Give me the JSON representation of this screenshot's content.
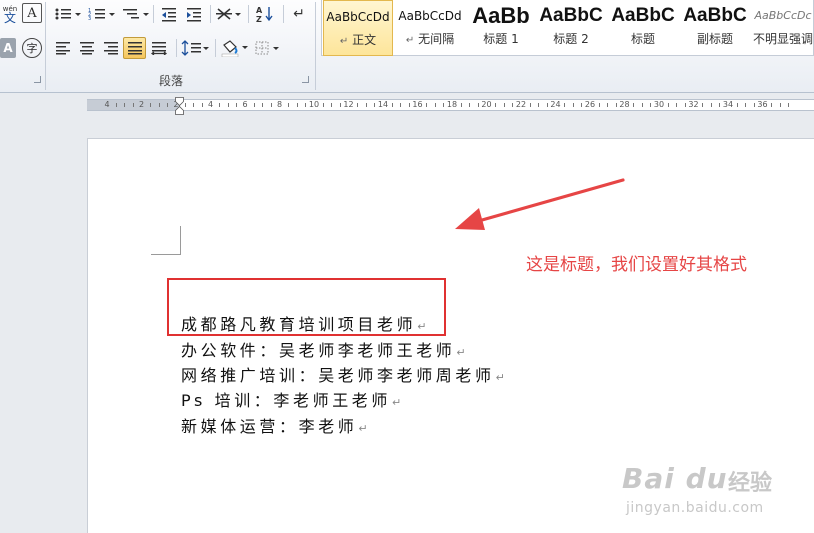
{
  "ribbon": {
    "font_group": {
      "phonetic_label": "wén",
      "phonetic_char": "文",
      "char_border": "A",
      "char_shading": "A",
      "enclose": "字"
    },
    "paragraph_group": {
      "label": "段落"
    },
    "styles": [
      {
        "preview": "AaBbCcDd",
        "name": "正文",
        "mark": "↵",
        "selected": true
      },
      {
        "preview": "AaBbCcDd",
        "name": "无间隔",
        "mark": "↵",
        "selected": false
      },
      {
        "preview": "AaBb",
        "name": "标题 1",
        "mark": "",
        "selected": false
      },
      {
        "preview": "AaBbC",
        "name": "标题 2",
        "mark": "",
        "selected": false
      },
      {
        "preview": "AaBbC",
        "name": "标题",
        "mark": "",
        "selected": false
      },
      {
        "preview": "AaBbC",
        "name": "副标题",
        "mark": "",
        "selected": false
      },
      {
        "preview": "AaBbCcDc",
        "name": "不明显强调",
        "mark": "",
        "selected": false
      }
    ]
  },
  "ruler": {
    "labels": [
      "4",
      "2",
      "2",
      "4",
      "6",
      "8",
      "10",
      "12",
      "14",
      "16",
      "18",
      "20",
      "22",
      "24",
      "26",
      "28",
      "30",
      "32",
      "34",
      "36"
    ]
  },
  "document": {
    "lines": [
      "成都路凡教育培训项目老师",
      "办公软件：吴老师李老师王老师",
      "网络推广培训：吴老师李老师周老师",
      "Ps 培训：李老师王老师",
      "新媒体运营：李老师"
    ],
    "paragraph_mark": "↵"
  },
  "annotation": {
    "text": "这是标题，我们设置好其格式",
    "color": "#e64545"
  },
  "watermark": {
    "logo": "Bai du",
    "product": "经验",
    "url": "jingyan.baidu.com"
  },
  "colors": {
    "highlight_box": "#e03131",
    "style_selected": "#fde59a"
  }
}
